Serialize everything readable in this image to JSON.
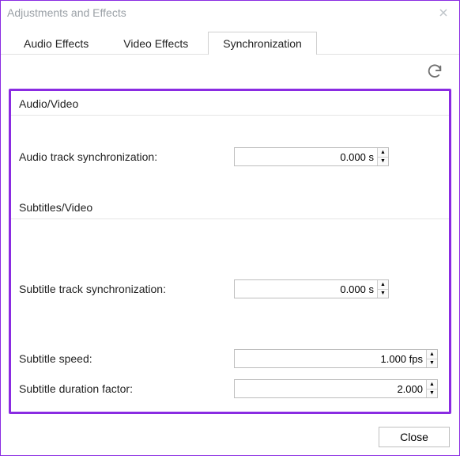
{
  "window": {
    "title": "Adjustments and Effects"
  },
  "tabs": [
    {
      "label": "Audio Effects",
      "active": false
    },
    {
      "label": "Video Effects",
      "active": false
    },
    {
      "label": "Synchronization",
      "active": true
    }
  ],
  "groups": {
    "av": {
      "title": "Audio/Video"
    },
    "sub": {
      "title": "Subtitles/Video"
    }
  },
  "fields": {
    "audio_sync": {
      "label": "Audio track synchronization:",
      "value": "0.000 s"
    },
    "subtitle_sync": {
      "label": "Subtitle track synchronization:",
      "value": "0.000 s"
    },
    "subtitle_speed": {
      "label": "Subtitle speed:",
      "value": "1.000 fps"
    },
    "subtitle_duration": {
      "label": "Subtitle duration factor:",
      "value": "2.000"
    }
  },
  "buttons": {
    "close": "Close"
  }
}
